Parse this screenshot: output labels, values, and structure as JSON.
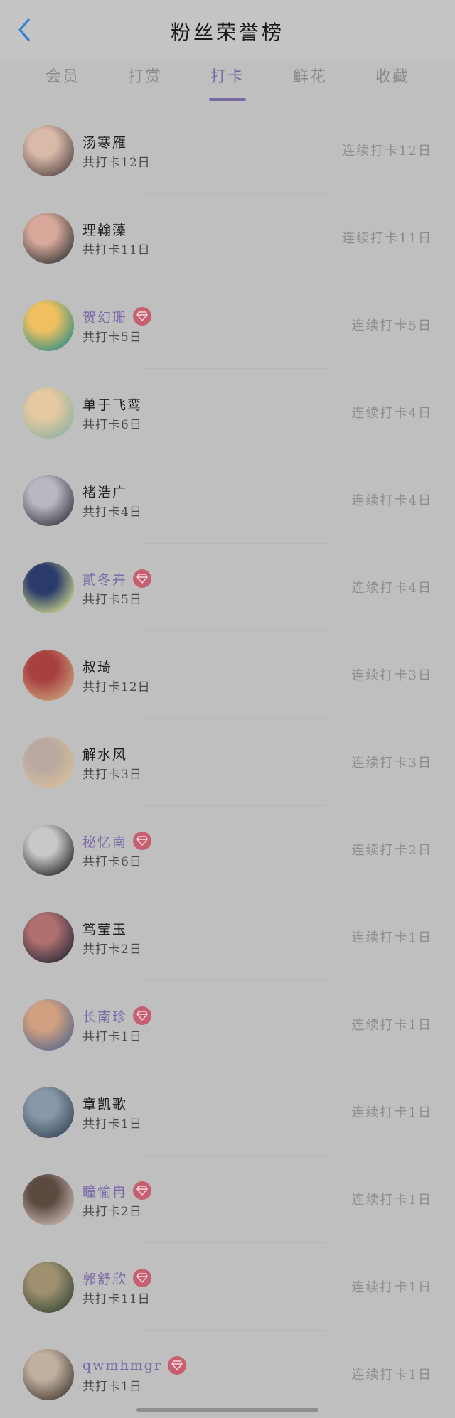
{
  "header": {
    "title": "粉丝荣誉榜",
    "back_icon": "chevron-left-icon",
    "accent_color": "#2f7fd0"
  },
  "tabs": [
    {
      "label": "会员",
      "active": false
    },
    {
      "label": "打赏",
      "active": false
    },
    {
      "label": "打卡",
      "active": true
    },
    {
      "label": "鲜花",
      "active": false
    },
    {
      "label": "收藏",
      "active": false
    }
  ],
  "colors": {
    "active_tab": "#7a6aa4",
    "vip_name": "#7a68a8",
    "vip_badge": "#c66070"
  },
  "rows": [
    {
      "name": "汤寒雁",
      "vip": false,
      "total": "共打卡12日",
      "streak": "连续打卡12日"
    },
    {
      "name": "理翰藻",
      "vip": false,
      "total": "共打卡11日",
      "streak": "连续打卡11日"
    },
    {
      "name": "贺幻珊",
      "vip": true,
      "total": "共打卡5日",
      "streak": "连续打卡5日"
    },
    {
      "name": "单于飞鸾",
      "vip": false,
      "total": "共打卡6日",
      "streak": "连续打卡4日"
    },
    {
      "name": "褚浩广",
      "vip": false,
      "total": "共打卡4日",
      "streak": "连续打卡4日"
    },
    {
      "name": "貳冬卉",
      "vip": true,
      "total": "共打卡5日",
      "streak": "连续打卡4日"
    },
    {
      "name": "叔琦",
      "vip": false,
      "total": "共打卡12日",
      "streak": "连续打卡3日"
    },
    {
      "name": "解水风",
      "vip": false,
      "total": "共打卡3日",
      "streak": "连续打卡3日"
    },
    {
      "name": "秘忆南",
      "vip": true,
      "total": "共打卡6日",
      "streak": "连续打卡2日"
    },
    {
      "name": "笃莹玉",
      "vip": false,
      "total": "共打卡2日",
      "streak": "连续打卡1日"
    },
    {
      "name": "长南珍",
      "vip": true,
      "total": "共打卡1日",
      "streak": "连续打卡1日"
    },
    {
      "name": "章凯歌",
      "vip": false,
      "total": "共打卡1日",
      "streak": "连续打卡1日"
    },
    {
      "name": "瞳愉冉",
      "vip": true,
      "total": "共打卡2日",
      "streak": "连续打卡1日"
    },
    {
      "name": "郭舒欣",
      "vip": true,
      "total": "共打卡11日",
      "streak": "连续打卡1日"
    },
    {
      "name": "qwmhmgr",
      "vip": true,
      "total": "共打卡1日",
      "streak": "连续打卡1日"
    }
  ]
}
